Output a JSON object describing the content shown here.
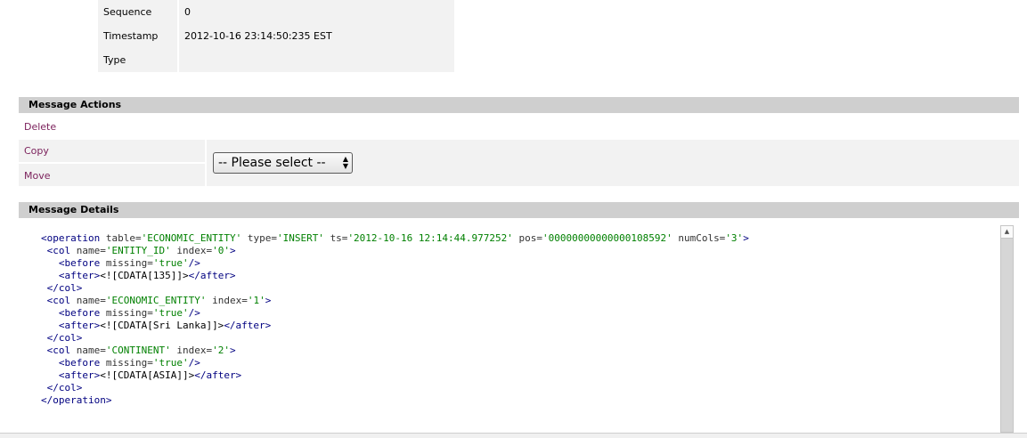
{
  "properties": [
    {
      "key": "Sequence",
      "value": "0"
    },
    {
      "key": "Timestamp",
      "value": "2012-10-16 23:14:50:235 EST"
    },
    {
      "key": "Type",
      "value": ""
    }
  ],
  "actions": {
    "header": "Message Actions",
    "delete": "Delete",
    "copy": "Copy",
    "move": "Move",
    "select_value": "-- Please select --"
  },
  "details": {
    "header": "Message Details"
  },
  "colors": {
    "link": "#7a1f5a",
    "header_bg": "#cfcfcf",
    "row_bg": "#f2f2f2",
    "xml_tag": "#000080",
    "xml_value": "#008000"
  },
  "icons": {
    "select_arrows": "updown-arrow-icon",
    "scroll_up": "arrow-up-icon"
  }
}
